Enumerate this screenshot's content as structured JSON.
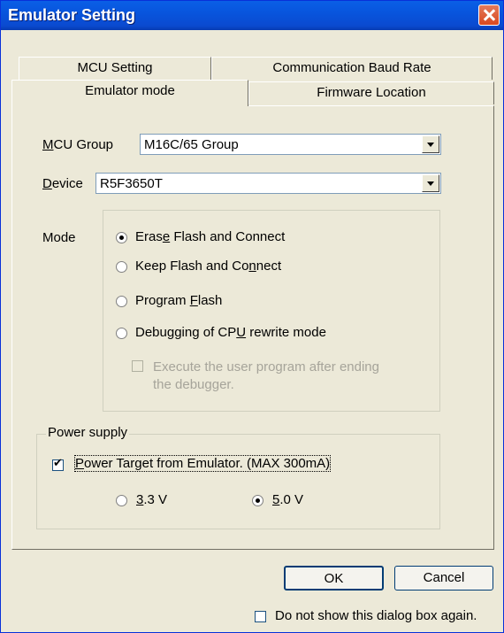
{
  "window": {
    "title": "Emulator Setting"
  },
  "tabs": {
    "row1": [
      "MCU Setting",
      "Communication Baud Rate"
    ],
    "row2": [
      "Emulator mode",
      "Firmware Location"
    ]
  },
  "mcu_group": {
    "label_u": "M",
    "label_rest": "CU Group",
    "value": "M16C/65 Group"
  },
  "device": {
    "label_u": "D",
    "label_rest": "evice",
    "value": "R5F3650T"
  },
  "mode": {
    "label": "Mode",
    "options": [
      {
        "pre": "Eras",
        "u": "e",
        "post": " Flash and Connect",
        "checked": true
      },
      {
        "pre": "Keep Flash and Co",
        "u": "n",
        "post": "nect",
        "checked": false
      },
      {
        "pre": "Program ",
        "u": "F",
        "post": "lash",
        "checked": false
      },
      {
        "pre": "Debugging of CP",
        "u": "U",
        "post": " rewrite mode",
        "checked": false
      }
    ],
    "sub_option_line1": "Execute the user program after ending",
    "sub_option_line2": "the debugger."
  },
  "power": {
    "legend": "Power supply",
    "target_pre": "",
    "target_u": "P",
    "target_post": "ower Target from Emulator. (MAX 300mA)",
    "v33_u": "3",
    "v33_post": ".3 V",
    "v50_u": "5",
    "v50_post": ".0 V"
  },
  "buttons": {
    "ok": "OK",
    "cancel": "Cancel"
  },
  "footer": {
    "dont_show": "Do not show this dialog box again."
  }
}
